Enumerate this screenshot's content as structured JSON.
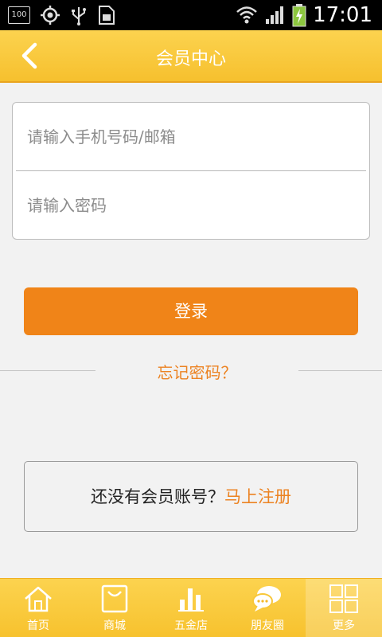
{
  "status_bar": {
    "battery_text": "100",
    "time": "17:01"
  },
  "header": {
    "title": "会员中心"
  },
  "form": {
    "phone_placeholder": "请输入手机号码/邮箱",
    "password_placeholder": "请输入密码"
  },
  "login": {
    "label": "登录"
  },
  "forgot": {
    "label": "忘记密码？"
  },
  "register": {
    "prompt": "还没有会员账号？",
    "link": "马上注册"
  },
  "bottom_nav": {
    "items": [
      {
        "label": "首页",
        "icon": "home-icon"
      },
      {
        "label": "商城",
        "icon": "shopping-bag-icon"
      },
      {
        "label": "五金店",
        "icon": "bar-chart-icon"
      },
      {
        "label": "朋友圈",
        "icon": "chat-bubble-icon"
      },
      {
        "label": "更多",
        "icon": "grid-icon"
      }
    ],
    "active_index": 4
  },
  "colors": {
    "accent_orange": "#f08418",
    "header_yellow": "#fcd34f",
    "link_orange": "#ec8322"
  }
}
